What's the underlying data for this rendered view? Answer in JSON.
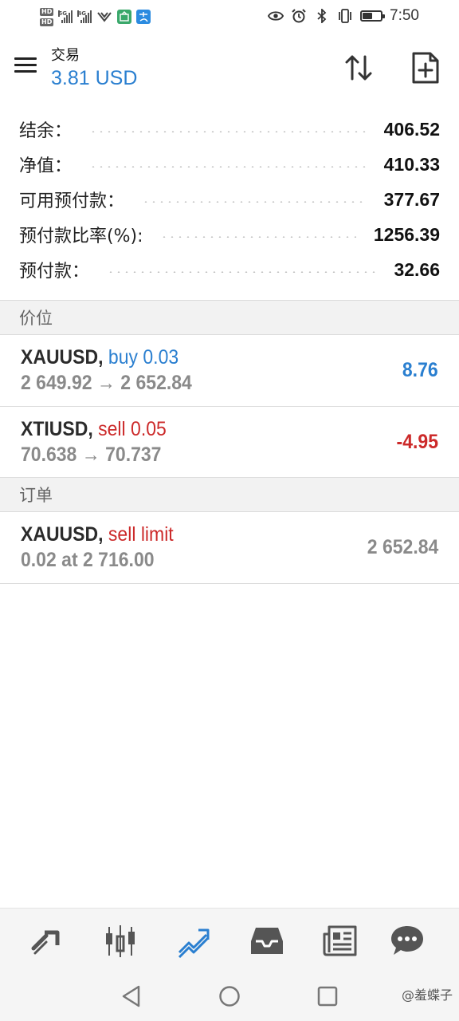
{
  "status_bar": {
    "sim1_badge": "HD",
    "sim2_badge": "HD",
    "sim1_network": "5G",
    "sim2_network": "4G",
    "time": "7:50",
    "icons": [
      "eye-icon",
      "alarm-icon",
      "bluetooth-icon",
      "vibrate-icon",
      "battery-icon"
    ]
  },
  "header": {
    "title": "交易",
    "subtitle": "3.81 USD"
  },
  "summary": [
    {
      "label": "结余：",
      "value": "406.52"
    },
    {
      "label": "净值：",
      "value": "410.33"
    },
    {
      "label": "可用预付款：",
      "value": "377.67"
    },
    {
      "label": "预付款比率(%):",
      "value": "1256.39"
    },
    {
      "label": "预付款：",
      "value": "32.66"
    }
  ],
  "positions_header": "价位",
  "positions": [
    {
      "symbol": "XAUUSD,",
      "action": "buy 0.03",
      "action_color": "blue",
      "prices": "2 649.92 → 2 652.84",
      "value": "8.76",
      "value_color": "blue"
    },
    {
      "symbol": "XTIUSD,",
      "action": "sell 0.05",
      "action_color": "red",
      "prices": "70.638 → 70.737",
      "value": "-4.95",
      "value_color": "red"
    }
  ],
  "orders_header": "订单",
  "orders": [
    {
      "symbol": "XAUUSD,",
      "action": "sell limit",
      "action_color": "red",
      "prices": "0.02 at 2 716.00",
      "value": "2 652.84",
      "value_color": "gray"
    }
  ],
  "tabbar": {
    "tabs": [
      "quotes-icon",
      "chart-icon",
      "trade-icon",
      "history-icon",
      "news-icon",
      "messages-icon"
    ],
    "active": "trade-icon",
    "active_color": "#2a7fd0"
  },
  "watermark": "@羞蝶子",
  "colors": {
    "accent": "#2a7fd0",
    "loss": "#cc2a2a"
  }
}
